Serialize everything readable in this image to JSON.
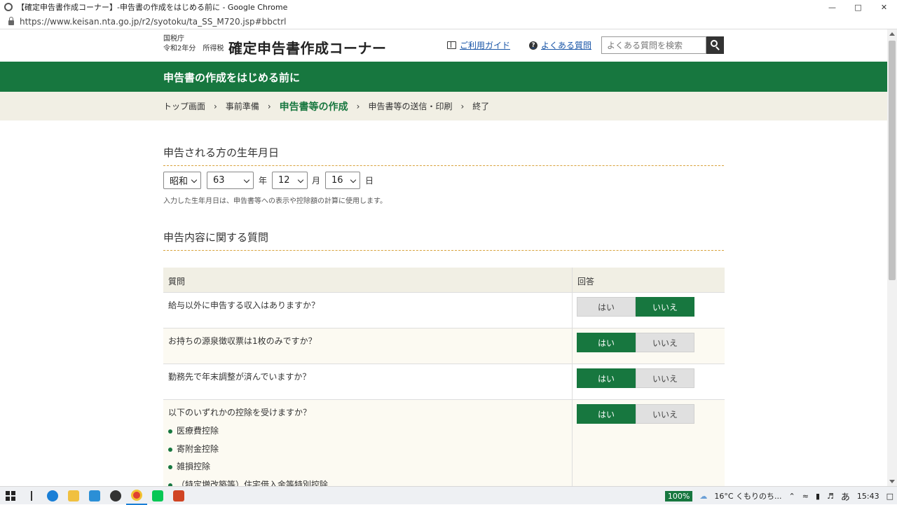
{
  "window": {
    "title": "【確定申告書作成コーナー】-申告書の作成をはじめる前に - Google Chrome",
    "url": "https://www.keisan.nta.go.jp/r2/syotoku/ta_SS_M720.jsp#bbctrl"
  },
  "header": {
    "agency": "国税庁",
    "year_line": "令和2年分　所得税",
    "site_title": "確定申告書作成コーナー",
    "guide_link": "ご利用ガイド",
    "faq_link": "よくある質問",
    "search_placeholder": "よくある質問を検索"
  },
  "banner": {
    "title": "申告書の作成をはじめる前に"
  },
  "breadcrumb": {
    "items": [
      "トップ画面",
      "事前準備",
      "申告書等の作成",
      "申告書等の送信・印刷",
      "終了"
    ],
    "current_index": 2
  },
  "birthdate": {
    "heading": "申告される方の生年月日",
    "era": "昭和",
    "year": "63",
    "year_unit": "年",
    "month": "12",
    "month_unit": "月",
    "day": "16",
    "day_unit": "日",
    "note": "入力した生年月日は、申告書等への表示や控除額の計算に使用します。"
  },
  "questions": {
    "heading": "申告内容に関する質問",
    "col_question": "質問",
    "col_answer": "回答",
    "yes_label": "はい",
    "no_label": "いいえ",
    "rows": [
      {
        "text": "給与以外に申告する収入はありますか？",
        "answer": "いいえ"
      },
      {
        "text": "お持ちの源泉徴収票は1枚のみですか？",
        "answer": "はい"
      },
      {
        "text": "勤務先で年末調整が済んでいますか？",
        "answer": "はい"
      },
      {
        "text": "以下のいずれかの控除を受けますか？",
        "answer": "はい",
        "bullets": [
          "医療費控除",
          "寄附金控除",
          "雑損控除",
          "（特定増改築等）住宅借入金等特別控除"
        ]
      }
    ]
  },
  "taskbar": {
    "zoom": "100%",
    "weather": "16°C くもりのち...",
    "ime": "あ",
    "time": "15:43"
  },
  "colors": {
    "accent_green": "#17773f",
    "crumb_bg": "#f1efe4",
    "link_blue": "#1a56a8"
  }
}
